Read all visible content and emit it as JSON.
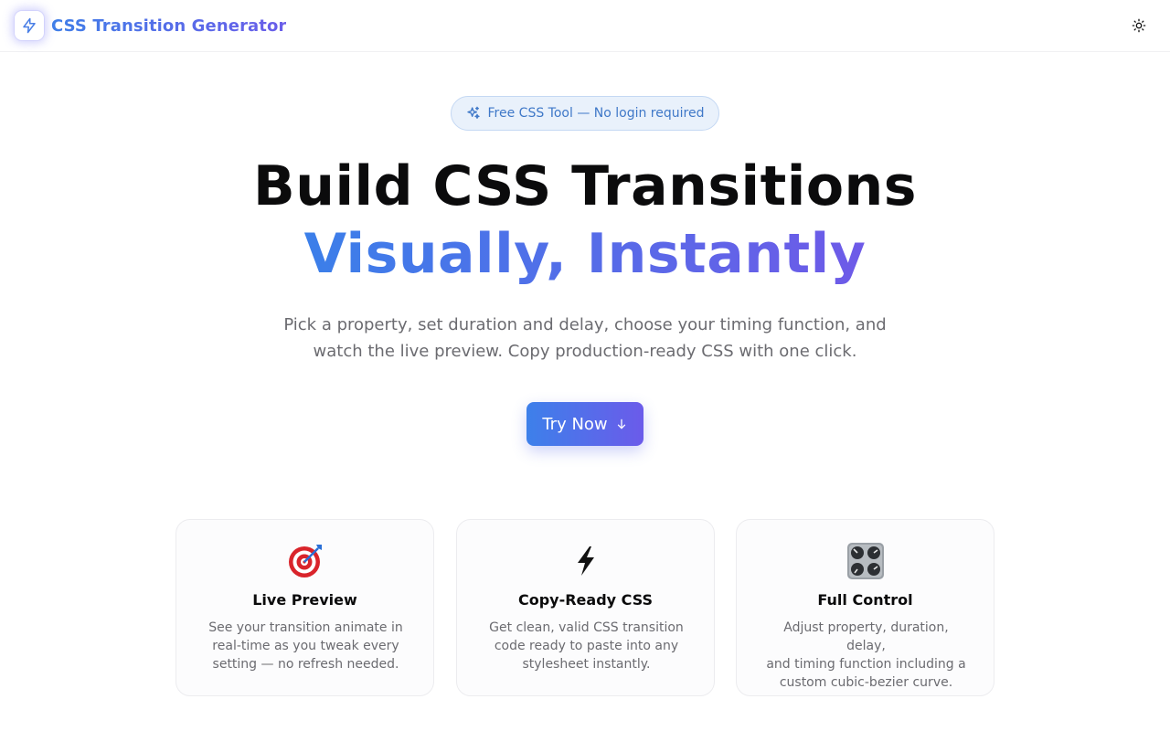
{
  "header": {
    "brand": "CSS Transition Generator",
    "logo_icon": "lightning-bolt-icon",
    "theme_toggle_icon": "sun-icon"
  },
  "badge": {
    "icon": "sparkles-icon",
    "label": "Free CSS Tool — No login required"
  },
  "hero": {
    "line1": "Build CSS Transitions",
    "line2": "Visually, Instantly",
    "subtitle_line1": "Pick a property, set duration and delay, choose your timing function, and",
    "subtitle_line2": "watch the live preview. Copy production-ready CSS with one click.",
    "cta_label": "Try Now",
    "cta_icon": "arrow-down-icon"
  },
  "features": [
    {
      "icon": "target-icon",
      "title": "Live Preview",
      "desc_lines": [
        "See your transition animate in",
        "real-time as you tweak every",
        "setting — no refresh needed."
      ]
    },
    {
      "icon": "lightning-icon",
      "title": "Copy-Ready CSS",
      "desc_lines": [
        "Get clean, valid CSS transition",
        "code ready to paste into any",
        "stylesheet instantly."
      ]
    },
    {
      "icon": "control-knobs-icon",
      "title": "Full Control",
      "desc_lines": [
        "Adjust property, duration, delay,",
        "and timing function including a",
        "custom cubic-bezier curve."
      ]
    }
  ],
  "colors": {
    "accent_start": "#3d80ea",
    "accent_end": "#6b5bea",
    "badge_bg": "#e9f1fb",
    "badge_text": "#3f78c8",
    "body_text": "#6b6b70"
  }
}
